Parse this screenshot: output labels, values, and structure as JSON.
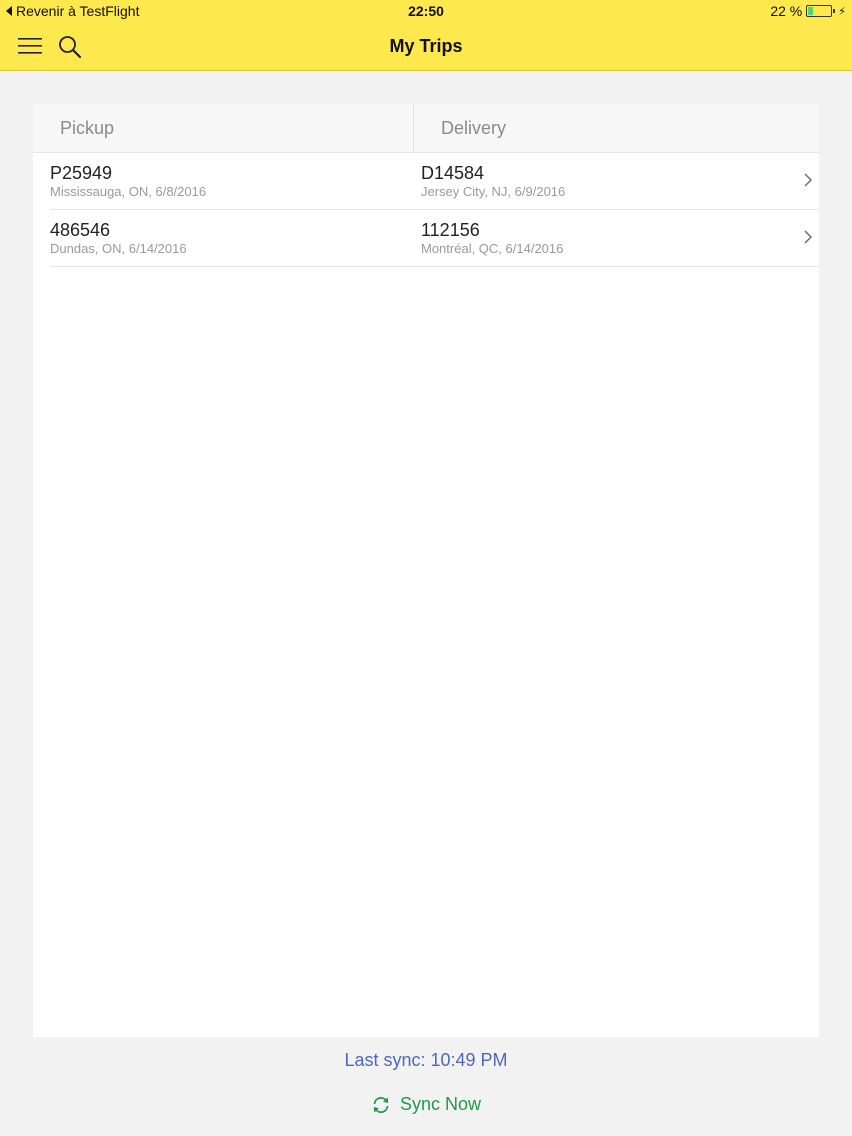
{
  "status_bar": {
    "back_label": "Revenir à TestFlight",
    "time": "22:50",
    "battery_text": "22 %",
    "battery_level": 0.22
  },
  "nav": {
    "title": "My Trips",
    "menu_icon": "hamburger-menu-icon",
    "search_icon": "search-icon"
  },
  "table": {
    "headers": {
      "pickup": "Pickup",
      "delivery": "Delivery"
    },
    "rows": [
      {
        "pickup_id": "P25949",
        "pickup_detail": "Mississauga, ON, 6/8/2016",
        "delivery_id": "D14584",
        "delivery_detail": "Jersey City, NJ, 6/9/2016"
      },
      {
        "pickup_id": "486546",
        "pickup_detail": "Dundas, ON, 6/14/2016",
        "delivery_id": "112156",
        "delivery_detail": "Montréal, QC, 6/14/2016"
      }
    ]
  },
  "footer": {
    "last_sync": "Last sync: 10:49 PM",
    "sync_now_label": "Sync Now",
    "sync_icon": "refresh-icon"
  },
  "colors": {
    "nav_background": "#fde84d",
    "last_sync_text": "#4f67b8",
    "sync_now_text": "#1f9a4a",
    "battery_fill": "#4cd964"
  }
}
